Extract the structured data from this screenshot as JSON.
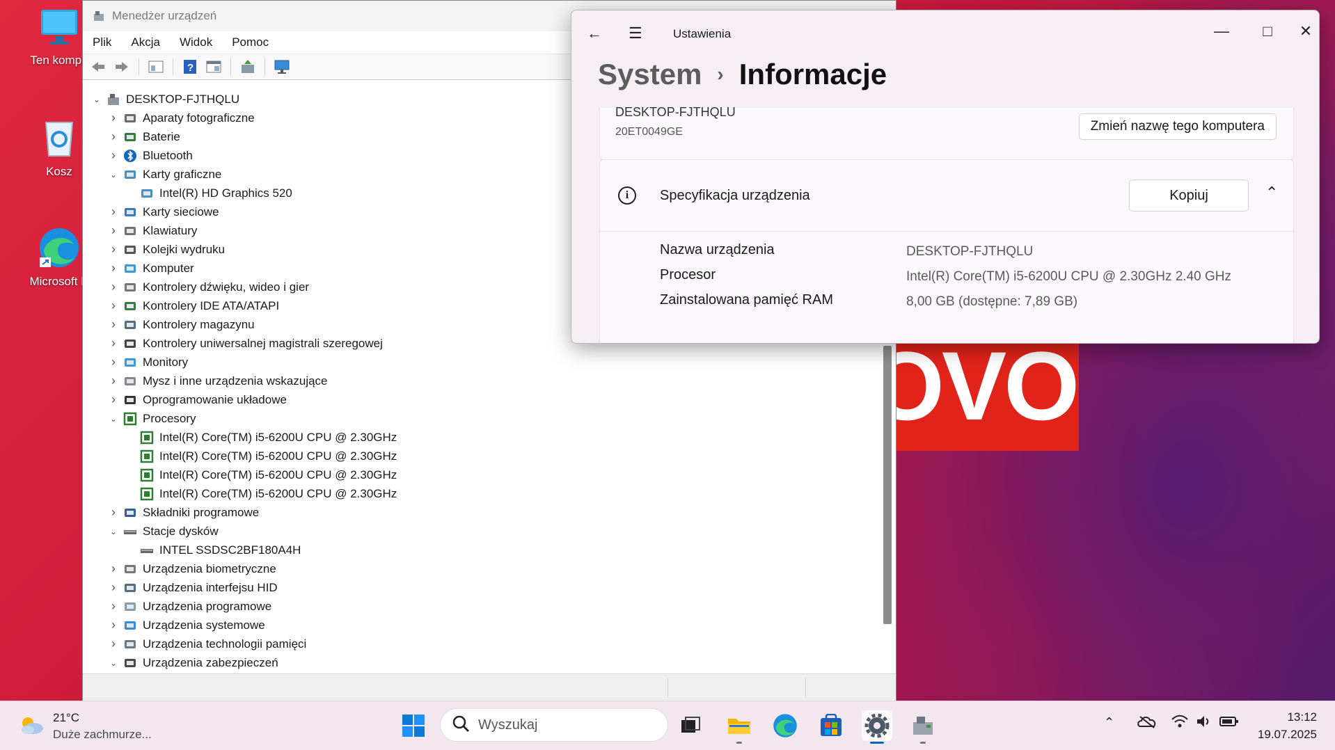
{
  "desktop": {
    "icons": [
      {
        "label": "Ten kompu"
      },
      {
        "label": "Kosz"
      },
      {
        "label": "Microsoft E"
      }
    ],
    "wallpaper_text": "OVO"
  },
  "device_manager": {
    "title": "Menedżer urządzeń",
    "menu": [
      "Plik",
      "Akcja",
      "Widok",
      "Pomoc"
    ],
    "root": "DESKTOP-FJTHQLU",
    "tree": [
      {
        "label": "Aparaty fotograficzne",
        "expanded": false,
        "level": 1,
        "icon": "camera-icon"
      },
      {
        "label": "Baterie",
        "expanded": false,
        "level": 1,
        "icon": "battery-icon"
      },
      {
        "label": "Bluetooth",
        "expanded": false,
        "level": 1,
        "icon": "bluetooth-icon"
      },
      {
        "label": "Karty graficzne",
        "expanded": true,
        "level": 1,
        "icon": "display-adapter-icon"
      },
      {
        "label": "Intel(R) HD Graphics 520",
        "level": 2,
        "icon": "display-adapter-icon"
      },
      {
        "label": "Karty sieciowe",
        "expanded": false,
        "level": 1,
        "icon": "network-adapter-icon"
      },
      {
        "label": "Klawiatury",
        "expanded": false,
        "level": 1,
        "icon": "keyboard-icon"
      },
      {
        "label": "Kolejki wydruku",
        "expanded": false,
        "level": 1,
        "icon": "printer-icon"
      },
      {
        "label": "Komputer",
        "expanded": false,
        "level": 1,
        "icon": "computer-icon"
      },
      {
        "label": "Kontrolery dźwięku, wideo i gier",
        "expanded": false,
        "level": 1,
        "icon": "speaker-icon"
      },
      {
        "label": "Kontrolery IDE ATA/ATAPI",
        "expanded": false,
        "level": 1,
        "icon": "ide-controller-icon"
      },
      {
        "label": "Kontrolery magazynu",
        "expanded": false,
        "level": 1,
        "icon": "storage-controller-icon"
      },
      {
        "label": "Kontrolery uniwersalnej magistrali szeregowej",
        "expanded": false,
        "level": 1,
        "icon": "usb-icon"
      },
      {
        "label": "Monitory",
        "expanded": false,
        "level": 1,
        "icon": "monitor-icon"
      },
      {
        "label": "Mysz i inne urządzenia wskazujące",
        "expanded": false,
        "level": 1,
        "icon": "mouse-icon"
      },
      {
        "label": "Oprogramowanie układowe",
        "expanded": false,
        "level": 1,
        "icon": "firmware-icon"
      },
      {
        "label": "Procesory",
        "expanded": true,
        "level": 1,
        "icon": "processor-icon"
      },
      {
        "label": "Intel(R) Core(TM) i5-6200U CPU @ 2.30GHz",
        "level": 2,
        "icon": "processor-icon"
      },
      {
        "label": "Intel(R) Core(TM) i5-6200U CPU @ 2.30GHz",
        "level": 2,
        "icon": "processor-icon"
      },
      {
        "label": "Intel(R) Core(TM) i5-6200U CPU @ 2.30GHz",
        "level": 2,
        "icon": "processor-icon"
      },
      {
        "label": "Intel(R) Core(TM) i5-6200U CPU @ 2.30GHz",
        "level": 2,
        "icon": "processor-icon"
      },
      {
        "label": "Składniki programowe",
        "expanded": false,
        "level": 1,
        "icon": "software-component-icon"
      },
      {
        "label": "Stacje dysków",
        "expanded": true,
        "level": 1,
        "icon": "disk-drive-icon"
      },
      {
        "label": "INTEL SSDSC2BF180A4H",
        "level": 2,
        "icon": "disk-drive-icon"
      },
      {
        "label": "Urządzenia biometryczne",
        "expanded": false,
        "level": 1,
        "icon": "fingerprint-icon"
      },
      {
        "label": "Urządzenia interfejsu HID",
        "expanded": false,
        "level": 1,
        "icon": "hid-icon"
      },
      {
        "label": "Urządzenia programowe",
        "expanded": false,
        "level": 1,
        "icon": "software-device-icon"
      },
      {
        "label": "Urządzenia systemowe",
        "expanded": false,
        "level": 1,
        "icon": "system-device-icon"
      },
      {
        "label": "Urządzenia technologii pamięci",
        "expanded": false,
        "level": 1,
        "icon": "memory-tech-icon"
      },
      {
        "label": "Urządzenia zabezpieczeń",
        "expanded": true,
        "level": 1,
        "icon": "security-device-icon"
      }
    ]
  },
  "settings": {
    "app_title": "Ustawienia",
    "breadcrumb_parent": "System",
    "breadcrumb_current": "Informacje",
    "device_name_top": "DESKTOP-FJTHQLU",
    "device_model": "20ET0049GE",
    "rename_button": "Zmień nazwę tego komputera",
    "spec_title": "Specyfikacja urządzenia",
    "copy_button": "Kopiuj",
    "specs": [
      {
        "key": "Nazwa urządzenia",
        "value": "DESKTOP-FJTHQLU"
      },
      {
        "key": "Procesor",
        "value": "Intel(R) Core(TM) i5-6200U CPU @ 2.30GHz   2.40 GHz"
      },
      {
        "key": "Zainstalowana pamięć RAM",
        "value": "8,00 GB (dostępne: 7,89 GB)"
      }
    ]
  },
  "taskbar": {
    "weather_temp": "21°C",
    "weather_desc": "Duże zachmurze...",
    "search_placeholder": "Wyszukaj",
    "time": "13:12",
    "date": "19.07.2025",
    "accent": "#0067c0"
  }
}
